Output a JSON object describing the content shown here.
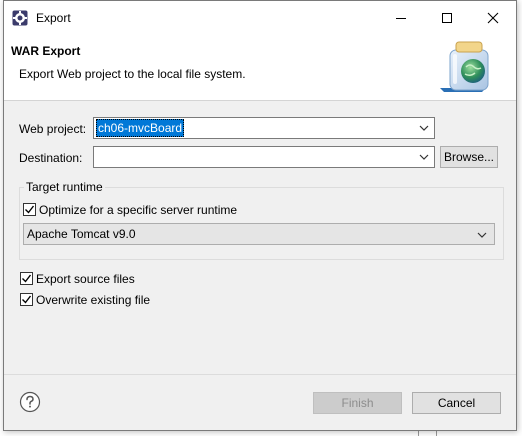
{
  "window": {
    "title": "Export"
  },
  "header": {
    "title": "WAR Export",
    "description": "Export Web project to the local file system."
  },
  "form": {
    "web_project_label": "Web project:",
    "web_project_value": "ch06-mvcBoard",
    "destination_label": "Destination:",
    "destination_value": "",
    "browse_label": "Browse..."
  },
  "target_runtime": {
    "legend": "Target runtime",
    "optimize_label": "Optimize for a specific server runtime",
    "optimize_checked": true,
    "runtime_value": "Apache Tomcat v9.0"
  },
  "options": {
    "export_source_label": "Export source files",
    "export_source_checked": true,
    "overwrite_label": "Overwrite existing file",
    "overwrite_checked": true
  },
  "buttons": {
    "finish_label": "Finish",
    "cancel_label": "Cancel"
  },
  "icons": {
    "app": "eclipse-gear-icon",
    "minimize": "minimize-icon",
    "maximize": "maximize-icon",
    "close": "close-icon",
    "header": "war-export-jar-globe-icon",
    "help": "help-icon",
    "dropdown": "chevron-down-icon",
    "checkbox": "check-icon"
  },
  "colors": {
    "selection": "#0078d7",
    "dialog_bg": "#f0f0f0",
    "header_bg": "#ffffff"
  }
}
